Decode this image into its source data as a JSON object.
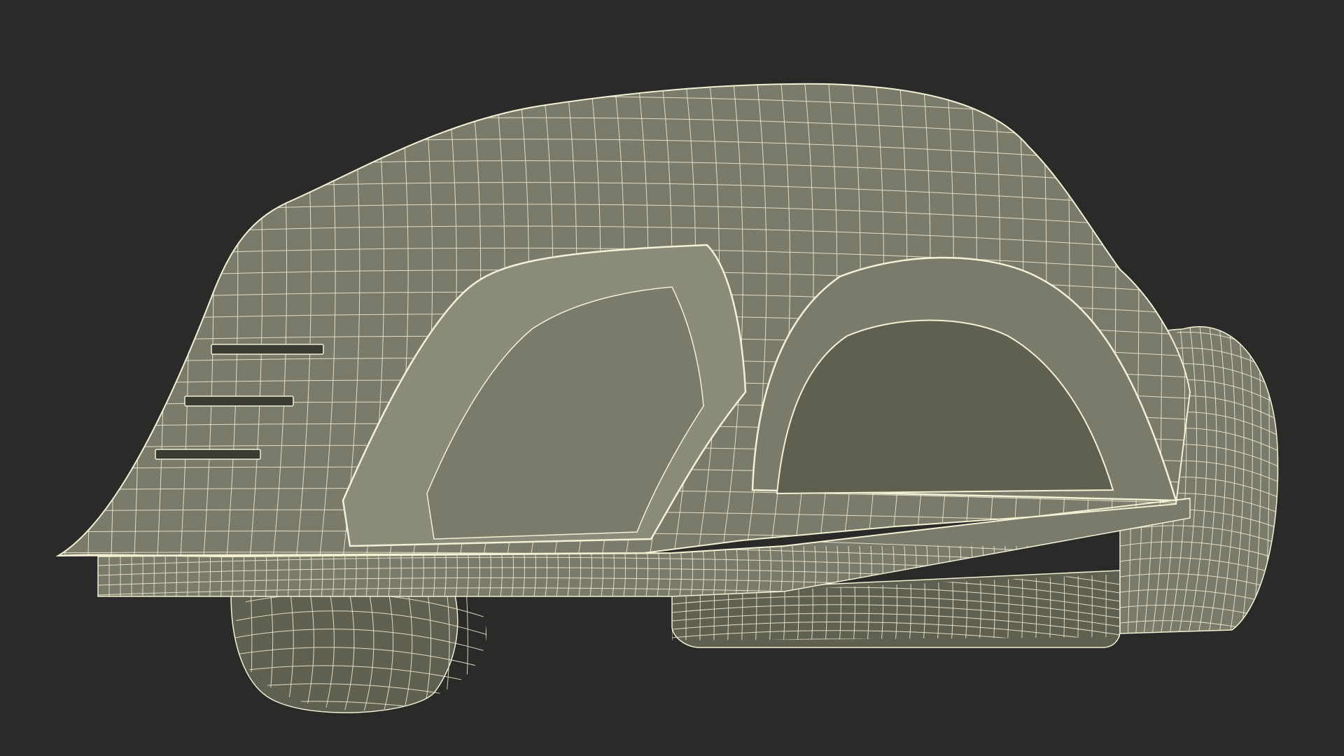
{
  "scene": {
    "subject": "wireframe-robotic-lawn-mower",
    "colors": {
      "background": "#2a2a29",
      "surface": "#7a7b6a",
      "surface_dark": "#5f604f",
      "surface_light": "#8a8b79",
      "wire": "#f3f0d6",
      "shadow": "#3a3b31"
    }
  }
}
